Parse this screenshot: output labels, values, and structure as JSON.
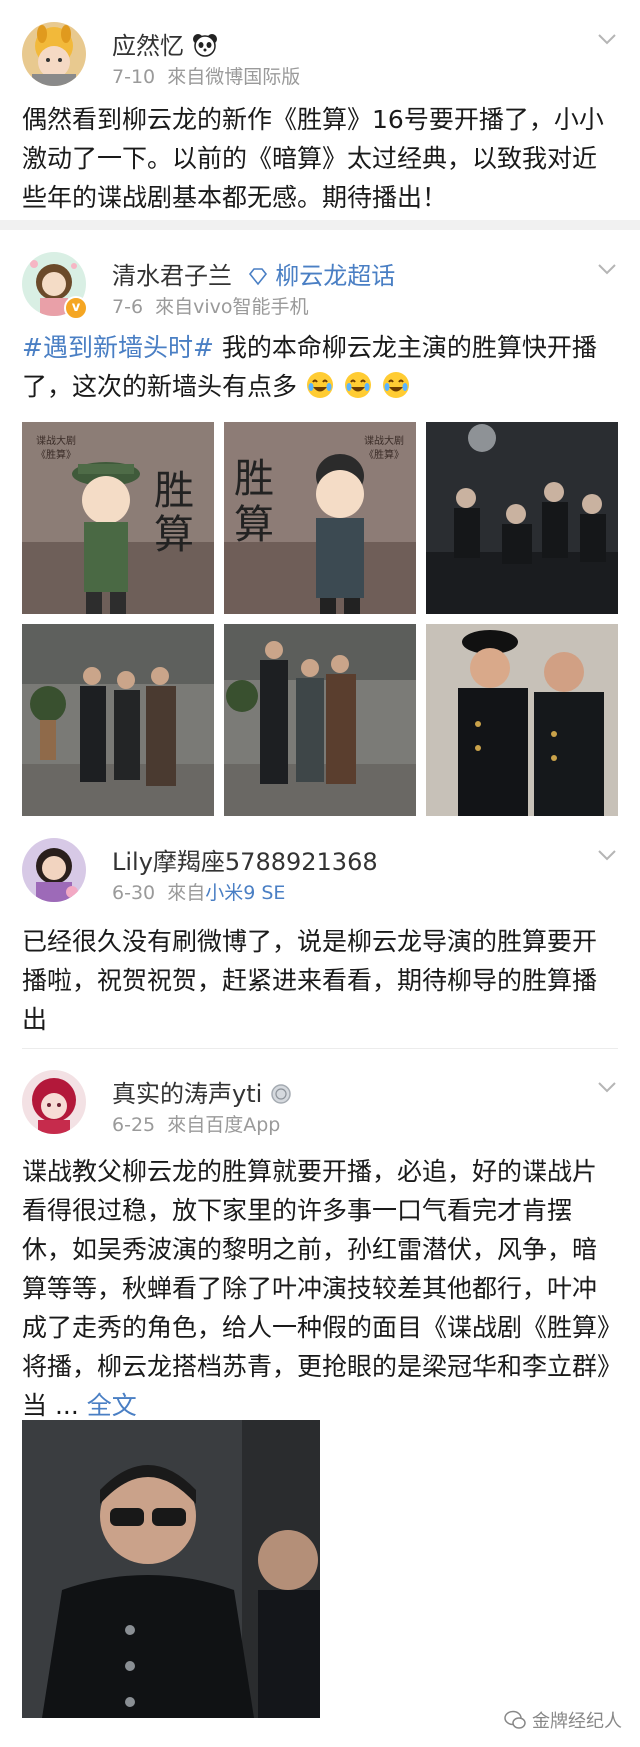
{
  "posts": [
    {
      "name": "应然忆",
      "date": "7-10",
      "source": "來自微博国际版",
      "text": "偶然看到柳云龙的新作《胜算》16号要开播了，小小激动了一下。以前的《暗算》太过经典，以致我对近些年的谍战剧基本都无感。期待播出！"
    },
    {
      "name": "清水君子兰",
      "super_topic": "柳云龙超话",
      "date": "7-6",
      "source": "來自vivo智能手机",
      "hashtag": "#遇到新墙头时#",
      "text": " 我的本命柳云龙主演的胜算快开播了，这次的新墙头有点多"
    },
    {
      "name": "Lily摩羯座5788921368",
      "date": "6-30",
      "source_prefix": "來自",
      "source_link": "小米9 SE",
      "text": "已经很久没有刷微博了，说是柳云龙导演的胜算要开播啦，祝贺祝贺，赶紧进来看看，期待柳导的胜算播出"
    },
    {
      "name": "真实的涛声yti",
      "date": "6-25",
      "source": "來自百度App",
      "text": "谍战教父柳云龙的胜算就要开播，必追，好的谍战片看得很过稳，放下家里的许多事一口气看完才肯摆休，如吴秀波演的黎明之前，孙红雷潜伏，风争，暗算等等，秋蝉看了除了叶冲演技较差其他都行，叶冲成了走秀的角色，给人一种假的面目《谍战剧《胜算》将播，柳云龙搭档苏青，更抢眼的是梁冠华和李立群》当 ... ",
      "more": "全文"
    }
  ],
  "poster": {
    "small_caption": "谍战大剧",
    "small_title": "《胜算》",
    "big_title_1": "胜",
    "big_title_2": "算"
  },
  "watermark": "金牌经纪人",
  "colors": {
    "link": "#4a7fc4",
    "meta": "#9a9a9a",
    "separator": "#f1f1f1"
  }
}
